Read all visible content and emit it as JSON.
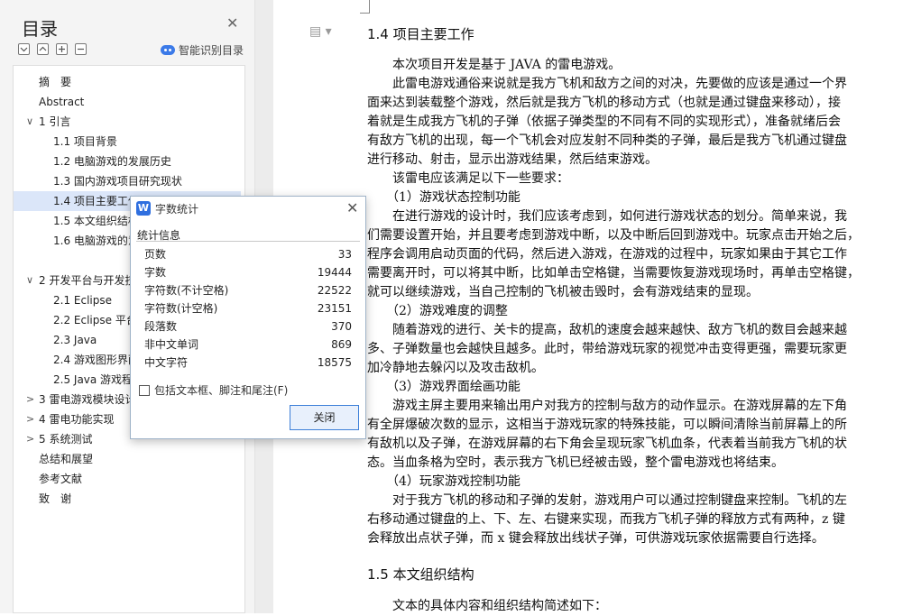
{
  "sidebar": {
    "title": "目录",
    "smart_label": "智能识别目录",
    "items": [
      {
        "label": "摘　要",
        "arrow": ""
      },
      {
        "label": "Abstract",
        "arrow": ""
      },
      {
        "label": "1 引言",
        "arrow": "∨"
      },
      {
        "label": "1.1 项目背景",
        "arrow": ""
      },
      {
        "label": "1.2 电脑游戏的发展历史",
        "arrow": ""
      },
      {
        "label": "1.3 国内游戏项目研究现状",
        "arrow": ""
      },
      {
        "label": "1.4 项目主要工作",
        "arrow": ""
      },
      {
        "label": "1.5 本文组织结构",
        "arrow": ""
      },
      {
        "label": "1.6 电脑游戏的意义",
        "arrow": ""
      },
      {
        "label": "2 开发平台与开发技术",
        "arrow": "∨"
      },
      {
        "label": "2.1 Eclipse",
        "arrow": ""
      },
      {
        "label": "2.2 Eclipse 平台",
        "arrow": ""
      },
      {
        "label": "2.3 Java",
        "arrow": ""
      },
      {
        "label": "2.4 游戏图形界面",
        "arrow": ""
      },
      {
        "label": "2.5 Java 游戏程序",
        "arrow": ""
      },
      {
        "label": "3 雷电游戏模块设计",
        "arrow": ">"
      },
      {
        "label": "4 雷电功能实现",
        "arrow": ">"
      },
      {
        "label": "5 系统测试",
        "arrow": ">"
      },
      {
        "label": "总结和展望",
        "arrow": ""
      },
      {
        "label": "参考文献",
        "arrow": ""
      },
      {
        "label": "致　谢",
        "arrow": ""
      }
    ]
  },
  "dialog": {
    "title": "字数统计",
    "section": "统计信息",
    "stats": [
      {
        "label": "页数",
        "value": "33"
      },
      {
        "label": "字数",
        "value": "19444"
      },
      {
        "label": "字符数(不计空格)",
        "value": "22522"
      },
      {
        "label": "字符数(计空格)",
        "value": "23151"
      },
      {
        "label": "段落数",
        "value": "370"
      },
      {
        "label": "非中文单词",
        "value": "869"
      },
      {
        "label": "中文字符",
        "value": "18575"
      }
    ],
    "checkbox_label": "包括文本框、脚注和尾注(F)",
    "close_button": "关闭"
  },
  "document": {
    "heading1": "1.4 项目主要工作",
    "lines": [
      "　　本次项目开发是基于 JAVA 的雷电游戏。",
      "　　此雷电游戏通俗来说就是我方飞机和敌方之间的对决，先要做的应该是通过一个界",
      "面来达到装载整个游戏，然后就是我方飞机的移动方式（也就是通过键盘来移动），接",
      "着就是生成我方飞机的子弹（依据子弹类型的不同有不同的实现形式），准备就绪后会",
      "有敌方飞机的出现，每一个飞机会对应发射不同种类的子弹，最后是我方飞机通过键盘",
      "进行移动、射击，显示出游戏结果，然后结束游戏。",
      "　　该雷电应该满足以下一些要求：",
      "　　（1）游戏状态控制功能",
      "　　在进行游戏的设计时，我们应该考虑到，如何进行游戏状态的划分。简单来说，我",
      "们需要设置开始，并且要考虑到游戏中断，以及中断后回到游戏中。玩家点击开始之后，",
      "程序会调用启动页面的代码，然后进入游戏，在游戏的过程中，玩家如果由于其它工作",
      "需要离开时，可以将其中断，比如单击空格键，当需要恢复游戏现场时，再单击空格键，",
      "就可以继续游戏，当自己控制的飞机被击毁时，会有游戏结束的显现。",
      "　　（2）游戏难度的调整",
      "　　随着游戏的进行、关卡的提高，敌机的速度会越来越快、敌方飞机的数目会越来越",
      "多、子弹数量也会越快且越多。此时，带给游戏玩家的视觉冲击变得更强，需要玩家更",
      "加冷静地去躲闪以及攻击敌机。",
      "　　（3）游戏界面绘画功能",
      "　　游戏主屏主要用来输出用户对我方的控制与敌方的动作显示。在游戏屏幕的左下角",
      "有全屏爆破次数的显示，这相当于游戏玩家的特殊技能，可以瞬间清除当前屏幕上的所",
      "有敌机以及子弹，在游戏屏幕的右下角会呈现玩家飞机血条，代表着当前我方飞机的状",
      "态。当血条格为空时，表示我方飞机已经被击毁，整个雷电游戏也将结束。",
      "　　（4）玩家游戏控制功能",
      "　　对于我方飞机的移动和子弹的发射，游戏用户可以通过控制键盘来控制。飞机的左",
      "右移动通过键盘的上、下、左、右键来实现，而我方飞机子弹的释放方式有两种，z 键",
      "会释放出点状子弹，而 x 键会释放出线状子弹，可供游戏玩家依据需要自行选择。"
    ],
    "heading2": "1.5 本文组织结构",
    "last_line": "　　文本的具体内容和组织结构简述如下："
  }
}
